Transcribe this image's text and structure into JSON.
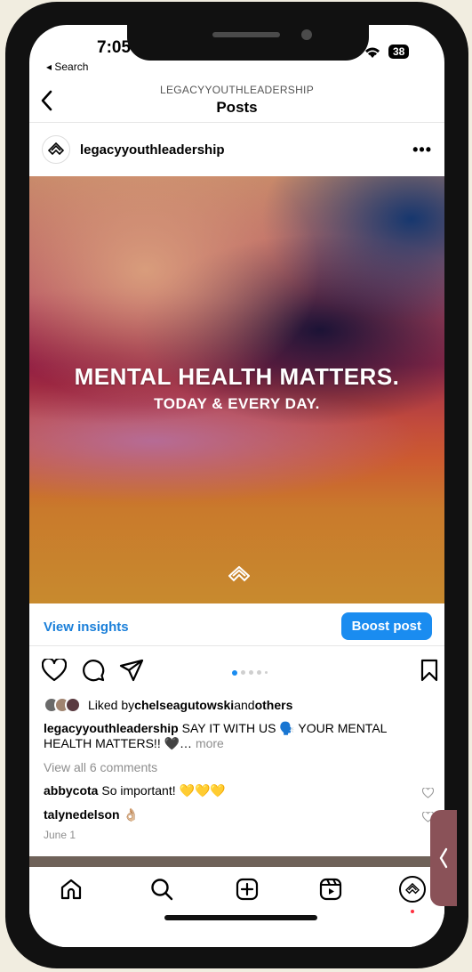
{
  "status": {
    "time": "7:05",
    "back_label": "◂ Search",
    "battery": "38"
  },
  "header": {
    "account": "LEGACYYOUTHLEADERSHIP",
    "title": "Posts"
  },
  "post": {
    "username": "legacyyouthleadership",
    "more": "•••",
    "image_text": {
      "line1": "MENTAL HEALTH MATTERS.",
      "line2": "TODAY & EVERY DAY."
    },
    "view_insights": "View insights",
    "boost": "Boost post",
    "carousel": {
      "count": 5,
      "active": 1
    },
    "likes": {
      "prefix": "Liked by ",
      "user": "chelseagutowski",
      "middle": " and ",
      "others": "others"
    },
    "caption": {
      "user": "legacyyouthleadership",
      "text": " SAY IT WITH US 🗣️ YOUR MENTAL HEALTH MATTERS!! 🖤",
      "ellipsis": "… ",
      "more": "more"
    },
    "view_comments": "View all 6 comments",
    "comments": [
      {
        "user": "abbycota",
        "text": " So important! 💛💛💛"
      },
      {
        "user": "talynedelson",
        "text": " 👌🏼"
      }
    ],
    "date": "June 1"
  },
  "colors": {
    "accent": "#1a8cf0",
    "link": "#1a7fd9",
    "notification": "#ff3040"
  },
  "icons": [
    "chevron-left-icon",
    "brand-logo-icon",
    "heart-icon",
    "comment-icon",
    "share-icon",
    "bookmark-icon",
    "home-icon",
    "search-icon",
    "create-icon",
    "reels-icon",
    "profile-icon"
  ]
}
